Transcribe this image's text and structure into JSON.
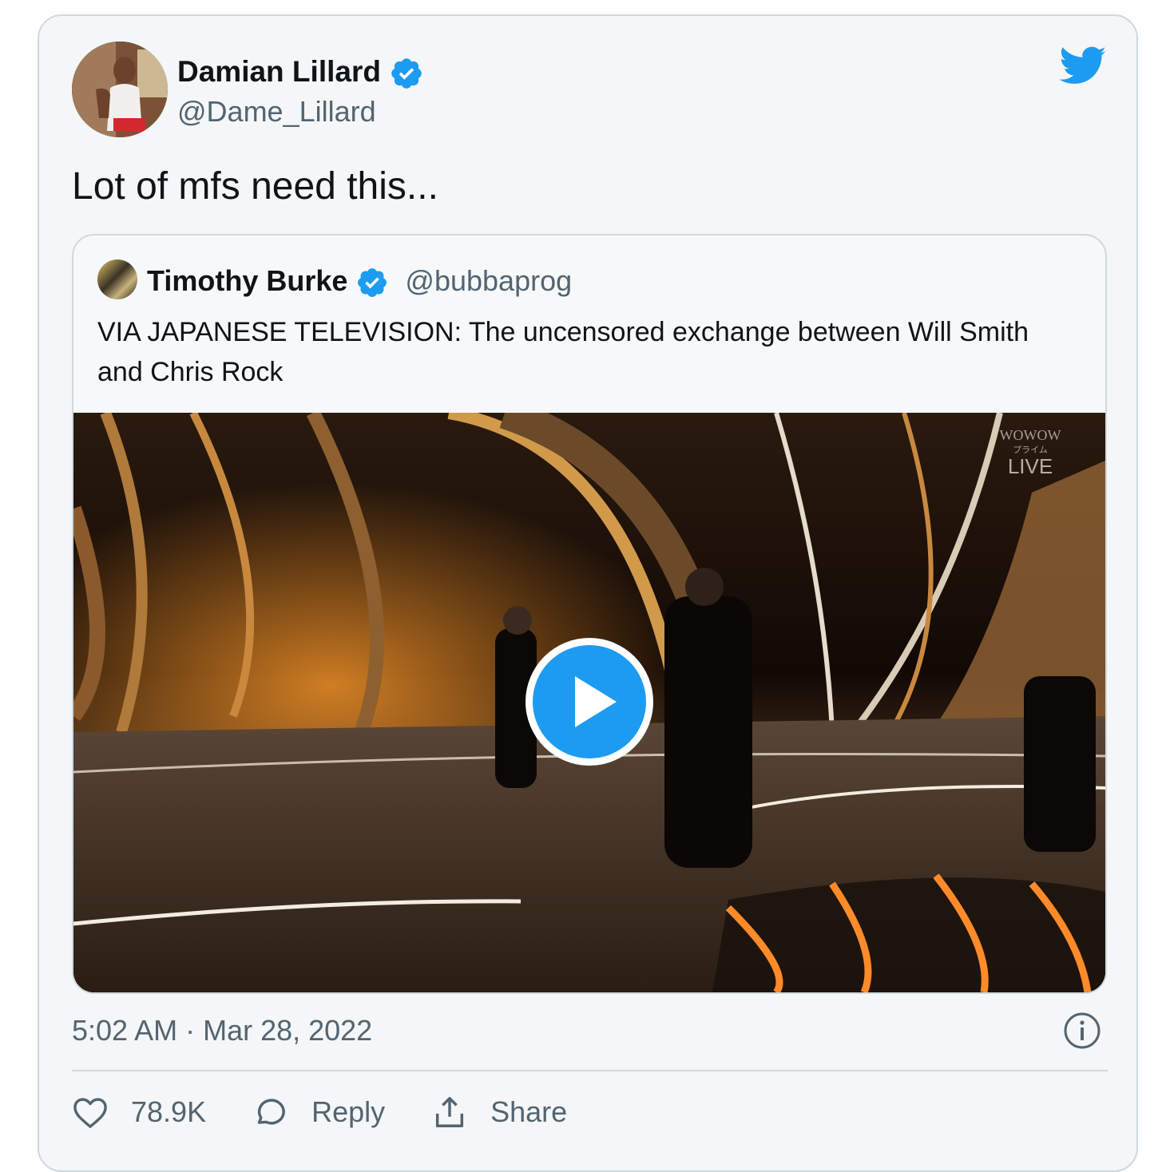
{
  "author": {
    "name": "Damian Lillard",
    "handle": "@Dame_Lillard",
    "verified": true
  },
  "tweet": {
    "text": "Lot of mfs need this..."
  },
  "quoted_tweet": {
    "name": "Timothy Burke",
    "handle": "@bubbaprog",
    "verified": true,
    "text": "VIA JAPANESE TELEVISION: The uncensored exchange between Will Smith and Chris Rock",
    "media": {
      "type": "video",
      "watermark_top": "WOWOW",
      "watermark_sub": "プライム",
      "watermark_live": "LIVE"
    }
  },
  "timestamp": "5:02 AM · Mar 28, 2022",
  "actions": {
    "like_count": "78.9K",
    "reply_label": "Reply",
    "share_label": "Share"
  },
  "colors": {
    "twitter_blue": "#1d9bf0",
    "verified_blue": "#1d9bf0",
    "secondary_text": "#536471",
    "card_background": "#f4f6f7"
  },
  "icons": {
    "brand": "twitter-bird-icon",
    "verified": "verified-badge-icon",
    "play": "play-icon",
    "info": "info-icon",
    "like": "heart-icon",
    "reply": "reply-bubble-icon",
    "share": "share-icon"
  }
}
